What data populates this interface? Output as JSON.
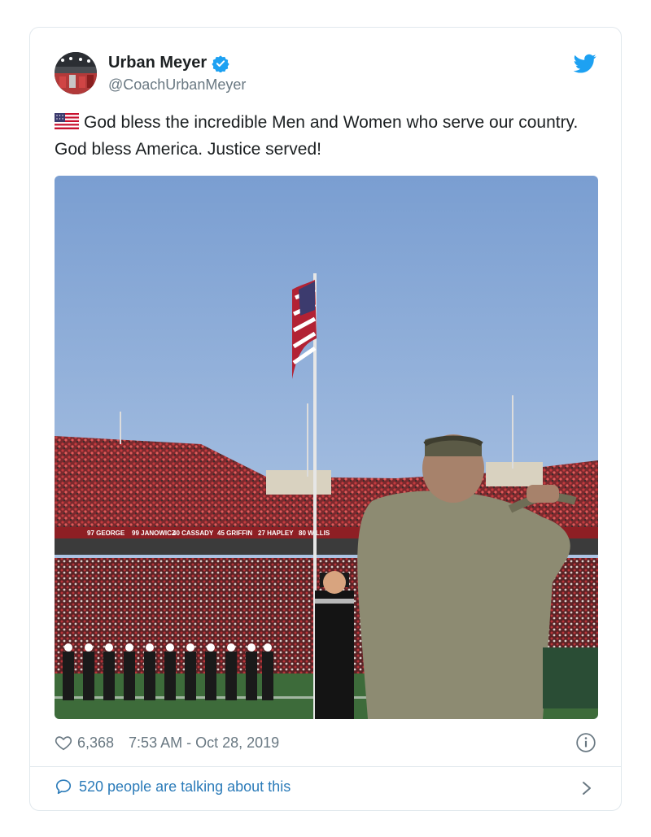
{
  "author": {
    "name": "Urban Meyer",
    "handle": "@CoachUrbanMeyer",
    "verified": true
  },
  "tweet": {
    "flag": "us-flag-emoji",
    "text": "God bless the incredible Men and Women who serve our country. God bless America. Justice served!"
  },
  "footer": {
    "likes": "6,368",
    "timestamp": "7:53 AM - Oct 28, 2019",
    "conversation": "520 people are talking about this"
  },
  "colors": {
    "twitter_blue": "#1da1f2",
    "link_blue": "#2b7bb9",
    "meta_gray": "#697882",
    "border": "#e1e8ed"
  },
  "icons": [
    "twitter-bird-icon",
    "verified-badge-icon",
    "heart-icon",
    "info-icon",
    "speech-bubble-icon",
    "chevron-right-icon"
  ]
}
